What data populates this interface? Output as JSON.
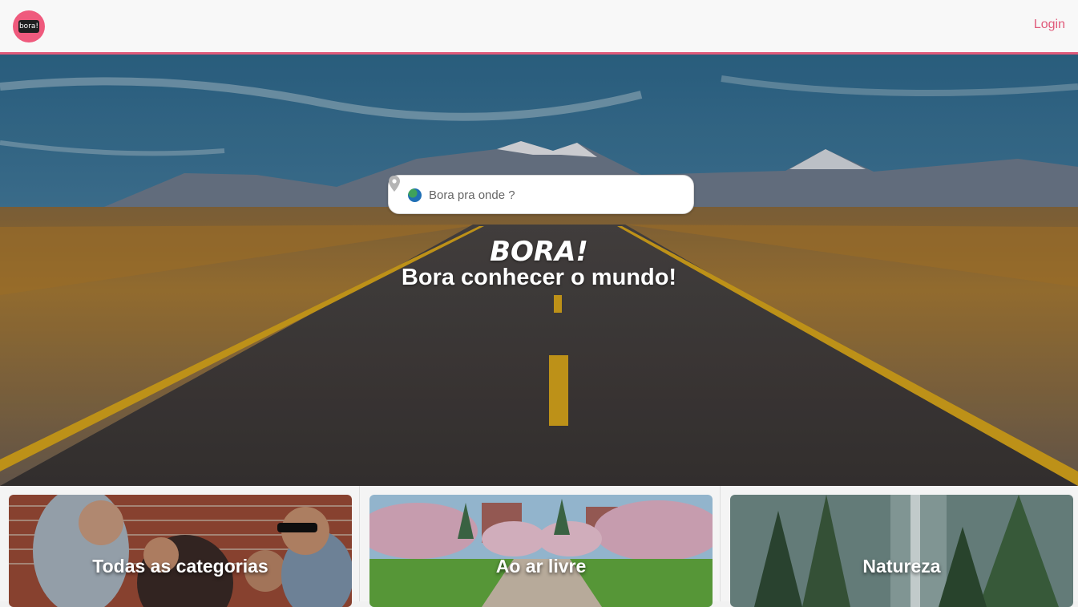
{
  "header": {
    "logo_text": "bora!",
    "login_label": "Login"
  },
  "hero": {
    "search_placeholder": "Bora pra onde ?",
    "brand": "BORA!",
    "tagline": "Bora conhecer o mundo!"
  },
  "categories": [
    {
      "label": "Todas as categorias"
    },
    {
      "label": "Ao ar livre"
    },
    {
      "label": "Natureza"
    }
  ],
  "colors": {
    "accent": "#e05a7a",
    "logo_bg": "#ef5a7d"
  }
}
